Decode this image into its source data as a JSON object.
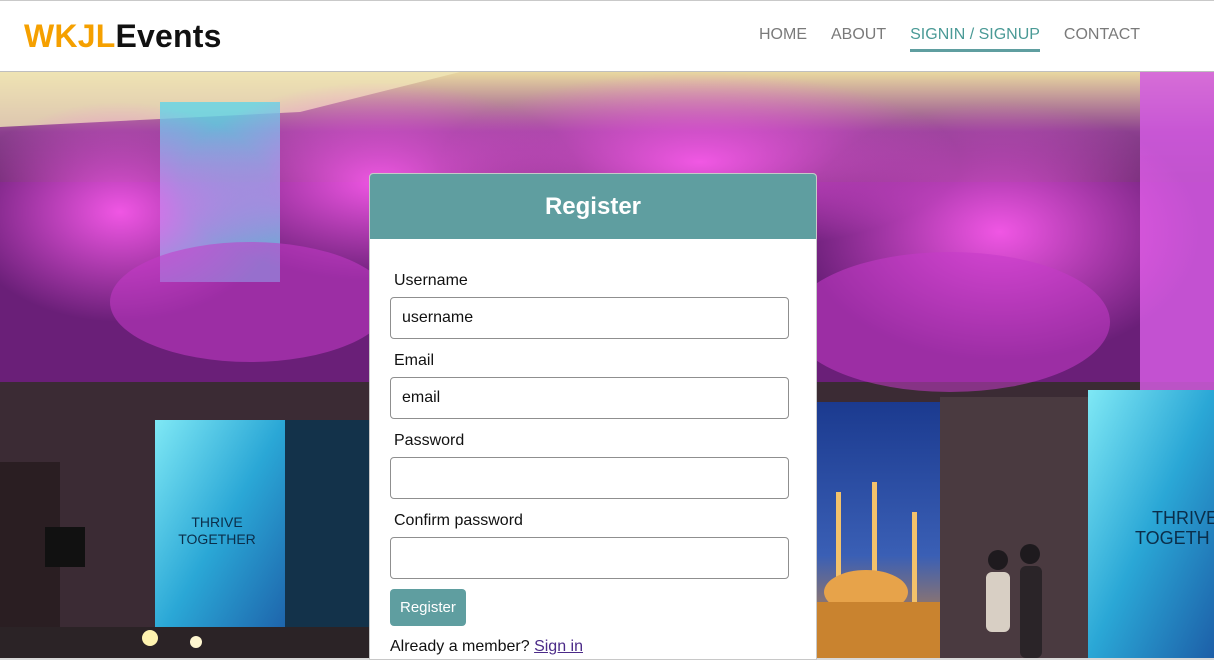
{
  "brand": {
    "part1": "WKJL",
    "part2": "Events",
    "color1": "#f5a000",
    "color2": "#111111"
  },
  "nav": {
    "items": [
      {
        "label": "HOME",
        "active": false
      },
      {
        "label": "ABOUT",
        "active": false
      },
      {
        "label": "SIGNIN / SIGNUP",
        "active": true
      },
      {
        "label": "CONTACT",
        "active": false
      }
    ],
    "active_color": "#5f9ea0"
  },
  "hero": {
    "screen_text_left": [
      "THRIVE",
      "TOGETHER"
    ],
    "screen_text_right": [
      "THRIVE",
      "TOGETH"
    ]
  },
  "form": {
    "title": "Register",
    "accent": "#5f9ea0",
    "fields": {
      "username": {
        "label": "Username",
        "placeholder": "username"
      },
      "email": {
        "label": "Email",
        "placeholder": "email"
      },
      "password": {
        "label": "Password",
        "placeholder": ""
      },
      "confirm": {
        "label": "Confirm password",
        "placeholder": ""
      }
    },
    "submit_label": "Register",
    "footer_text": "Already a member?",
    "footer_link": "Sign in"
  }
}
